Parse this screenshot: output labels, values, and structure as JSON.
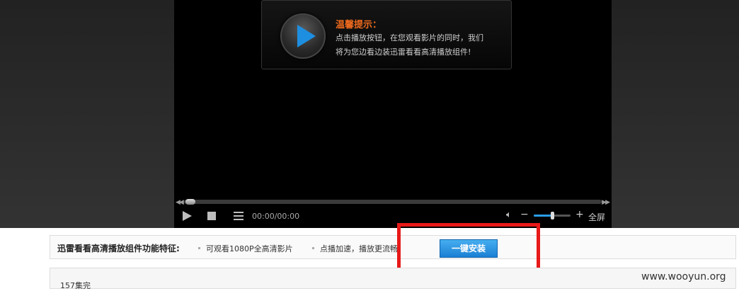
{
  "notice": {
    "title": "温馨提示：",
    "line1": "点击播放按钮，在您观看影片的同时，我们",
    "line2": "将为您边看边装迅雷看看高清播放组件!"
  },
  "controls": {
    "time": "00:00/00:00",
    "fullscreen": "全屏",
    "volume_minus": "−",
    "volume_plus": "+",
    "volume_level": 0.55,
    "progress": 0
  },
  "features": {
    "title": "迅雷看看高清播放组件功能特征:",
    "items": [
      "可观看1080P全高清影片",
      "点播加速，播放更流畅"
    ],
    "install_label": "一键安装"
  },
  "episode": {
    "text": "157集完"
  },
  "watermark": "www.wooyun.org",
  "colors": {
    "accent_orange": "#f06b1e",
    "button_blue": "#1a7fd4",
    "highlight_red": "#e81919"
  }
}
